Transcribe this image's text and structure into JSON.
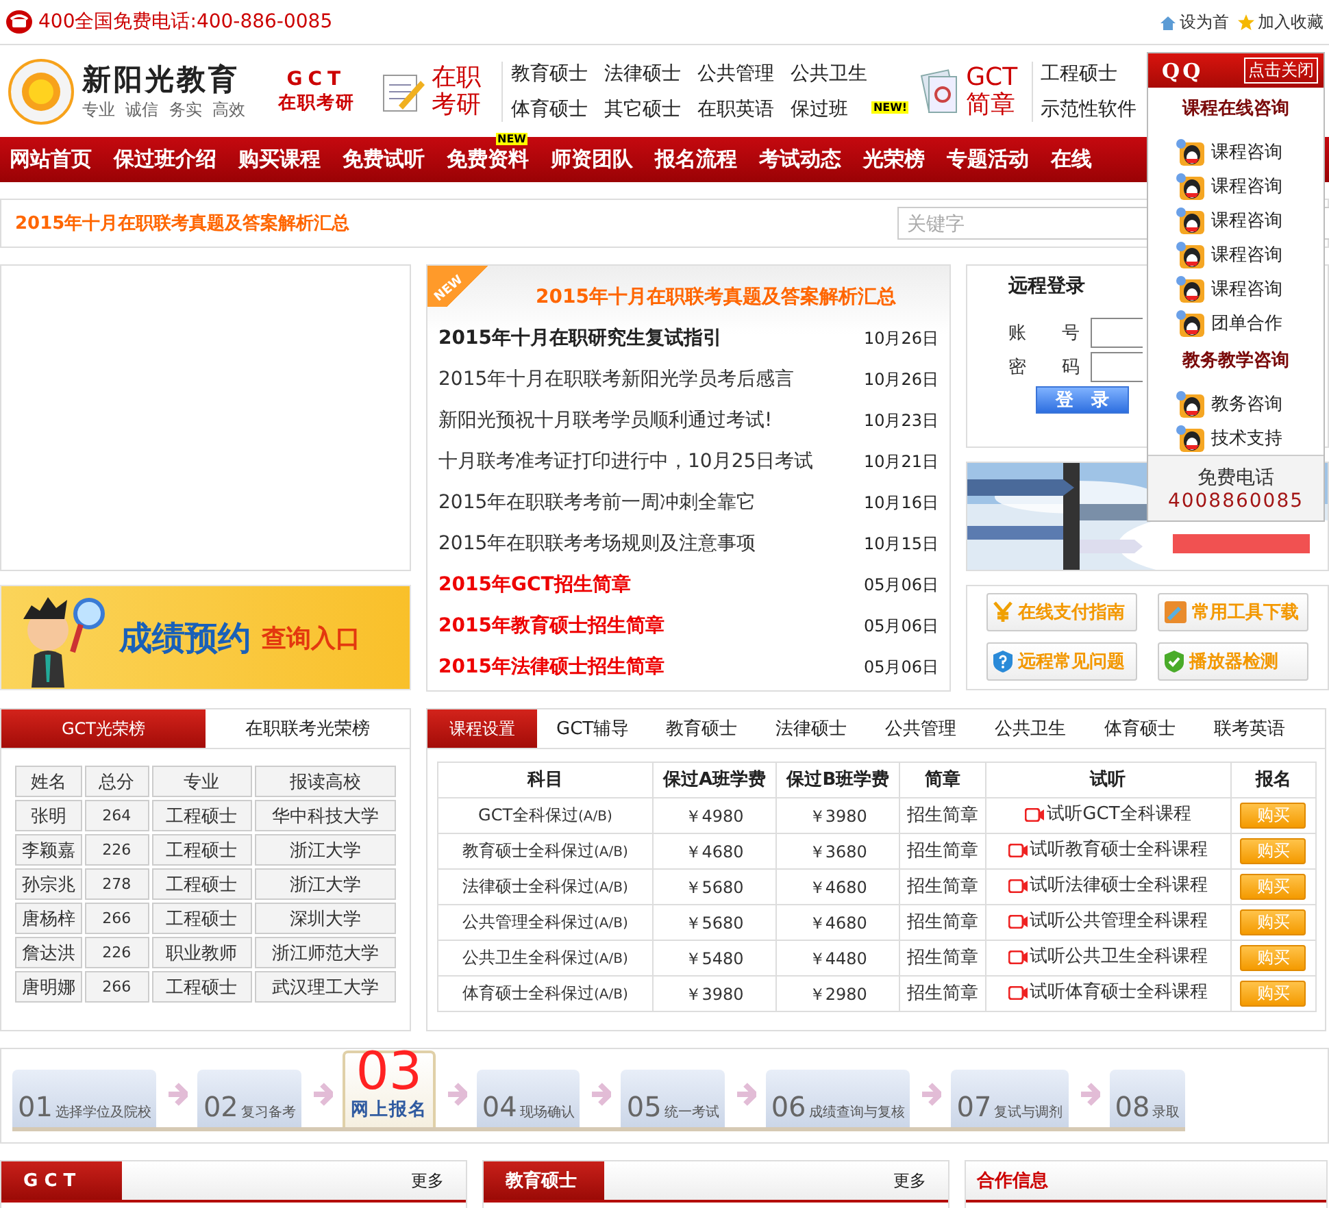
{
  "top_bar": {
    "phone": "400全国免费电话:400-886-0085",
    "links": [
      {
        "label": "设为首",
        "kind": "home"
      },
      {
        "label": "加入收藏",
        "kind": "star"
      }
    ]
  },
  "header": {
    "logo": {
      "name": "新阳光教育",
      "slogan": "专业  诚信  务实  高效"
    },
    "tagline": {
      "top": "GCT",
      "bottom": "在职考研"
    },
    "promo_1": "在职考研",
    "links_1": [
      {
        "label": "教育硕士"
      },
      {
        "label": "法律硕士"
      },
      {
        "label": "公共管理"
      },
      {
        "label": "公共卫生"
      },
      {
        "label": "体育硕士"
      },
      {
        "label": "其它硕士"
      },
      {
        "label": "在职英语"
      },
      {
        "label": "保过班",
        "badge": "NEW!"
      }
    ],
    "promo_2": "GCT简章",
    "links_2": [
      {
        "label": "工程硕士"
      },
      {
        "label": "示范性软件"
      }
    ]
  },
  "nav": [
    {
      "label": "网站首页"
    },
    {
      "label": "保过班介绍"
    },
    {
      "label": "购买课程"
    },
    {
      "label": "免费试听"
    },
    {
      "label": "免费资料",
      "badge": "NEW"
    },
    {
      "label": "师资团队"
    },
    {
      "label": "报名流程"
    },
    {
      "label": "考试动态"
    },
    {
      "label": "光荣榜"
    },
    {
      "label": "专题活动"
    },
    {
      "label": "在线"
    }
  ],
  "headline_bar": {
    "text": "2015年十月在职联考真题及答案解析汇总",
    "search_placeholder": "关键字"
  },
  "score_banner": {
    "title": "成绩预约",
    "subtitle": "查询入口"
  },
  "news": {
    "ribbon": "NEW",
    "title": "2015年十月在职联考真题及答案解析汇总",
    "items": [
      {
        "title": "2015年十月在职研究生复试指引",
        "date": "10月26日",
        "kind": "bold"
      },
      {
        "title": "2015年十月在职联考新阳光学员考后感言",
        "date": "10月26日",
        "kind": "normal"
      },
      {
        "title": "新阳光预祝十月联考学员顺利通过考试!",
        "date": "10月23日",
        "kind": "normal"
      },
      {
        "title": "十月联考准考证打印进行中，10月25日考试",
        "date": "10月21日",
        "kind": "normal"
      },
      {
        "title": "2015年在职联考考前一周冲刺全靠它",
        "date": "10月16日",
        "kind": "normal"
      },
      {
        "title": "2015年在职联考考场规则及注意事项",
        "date": "10月15日",
        "kind": "normal"
      },
      {
        "title": "2015年GCT招生简章",
        "date": "05月06日",
        "kind": "red"
      },
      {
        "title": "2015年教育硕士招生简章",
        "date": "05月06日",
        "kind": "red"
      },
      {
        "title": "2015年法律硕士招生简章",
        "date": "05月06日",
        "kind": "red"
      }
    ]
  },
  "login": {
    "title": "远程登录",
    "fields": [
      {
        "label": "账　　号"
      },
      {
        "label": "密　　码"
      }
    ],
    "button": "登　录"
  },
  "tools": [
    {
      "label": "在线支付指南",
      "kind": "yen"
    },
    {
      "label": "常用工具下载",
      "kind": "tools"
    },
    {
      "label": "远程常见问题",
      "kind": "help"
    },
    {
      "label": "播放器检测",
      "kind": "check"
    }
  ],
  "honor": {
    "tabs": [
      {
        "label": "GCT光荣榜",
        "selected": true
      },
      {
        "label": "在职联考光荣榜",
        "selected": false
      }
    ],
    "columns": [
      "姓名",
      "总分",
      "专业",
      "报读高校"
    ],
    "rows": [
      [
        "张明",
        "264",
        "工程硕士",
        "华中科技大学"
      ],
      [
        "李颖嘉",
        "226",
        "工程硕士",
        "浙江大学"
      ],
      [
        "孙宗兆",
        "278",
        "工程硕士",
        "浙江大学"
      ],
      [
        "唐杨梓",
        "266",
        "工程硕士",
        "深圳大学"
      ],
      [
        "詹达洪",
        "226",
        "职业教师",
        "浙江师范大学"
      ],
      [
        "唐明娜",
        "266",
        "工程硕士",
        "武汉理工大学"
      ]
    ]
  },
  "courses": {
    "tabs": [
      {
        "label": "课程设置",
        "selected": true
      },
      {
        "label": "GCT辅导",
        "selected": false
      },
      {
        "label": "教育硕士",
        "selected": false
      },
      {
        "label": "法律硕士",
        "selected": false
      },
      {
        "label": "公共管理",
        "selected": false
      },
      {
        "label": "公共卫生",
        "selected": false
      },
      {
        "label": "体育硕士",
        "selected": false
      },
      {
        "label": "联考英语",
        "selected": false
      }
    ],
    "columns": [
      "科目",
      "保过A班学费",
      "保过B班学费",
      "简章",
      "试听",
      "报名"
    ],
    "rows": [
      {
        "subject": "GCT全科保过",
        "note": "(A/B)",
        "price_a": "￥4980",
        "price_b": "￥3980",
        "brochure": "招生简章",
        "trial": "试听GCT全科课程",
        "buy": "购买"
      },
      {
        "subject": "教育硕士全科保过",
        "note": "(A/B)",
        "price_a": "￥4680",
        "price_b": "￥3680",
        "brochure": "招生简章",
        "trial": "试听教育硕士全科课程",
        "buy": "购买"
      },
      {
        "subject": "法律硕士全科保过",
        "note": "(A/B)",
        "price_a": "￥5680",
        "price_b": "￥4680",
        "brochure": "招生简章",
        "trial": "试听法律硕士全科课程",
        "buy": "购买"
      },
      {
        "subject": "公共管理全科保过",
        "note": "(A/B)",
        "price_a": "￥5680",
        "price_b": "￥4680",
        "brochure": "招生简章",
        "trial": "试听公共管理全科课程",
        "buy": "购买"
      },
      {
        "subject": "公共卫生全科保过",
        "note": "(A/B)",
        "price_a": "￥5480",
        "price_b": "￥4480",
        "brochure": "招生简章",
        "trial": "试听公共卫生全科课程",
        "buy": "购买"
      },
      {
        "subject": "体育硕士全科保过",
        "note": "(A/B)",
        "price_a": "￥3980",
        "price_b": "￥2980",
        "brochure": "招生简章",
        "trial": "试听体育硕士全科课程",
        "buy": "购买"
      }
    ]
  },
  "steps": [
    {
      "number": "01",
      "label": "选择学位及院校",
      "selected": false
    },
    {
      "number": "02",
      "label": "复习备考",
      "selected": false
    },
    {
      "number": "03",
      "label": "网上报名",
      "selected": true
    },
    {
      "number": "04",
      "label": "现场确认",
      "selected": false
    },
    {
      "number": "05",
      "label": "统一考试",
      "selected": false
    },
    {
      "number": "06",
      "label": "成绩查询与复核",
      "selected": false
    },
    {
      "number": "07",
      "label": "复试与调剂",
      "selected": false
    },
    {
      "number": "08",
      "label": "录取",
      "selected": false
    }
  ],
  "bottom_panels": [
    {
      "title": "G C T",
      "more": "更多",
      "kind": "tab"
    },
    {
      "title": "教育硕士",
      "more": "更多",
      "kind": "tab"
    },
    {
      "title": "合作信息",
      "kind": "plain"
    }
  ],
  "qq_panel": {
    "logo": "QQ",
    "close": "点击关闭",
    "groups": [
      {
        "title": "课程在线咨询",
        "items": [
          "课程咨询",
          "课程咨询",
          "课程咨询",
          "课程咨询",
          "课程咨询",
          "团单合作"
        ]
      },
      {
        "title": "教务教学咨询",
        "items": [
          "教务咨询",
          "技术支持"
        ]
      }
    ],
    "phone_label": "免费电话",
    "phone": "4008860085"
  }
}
